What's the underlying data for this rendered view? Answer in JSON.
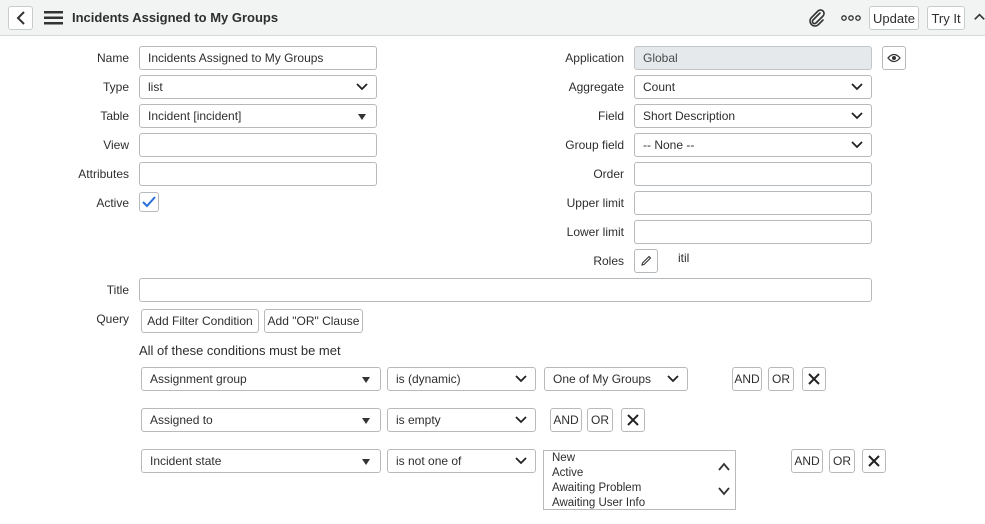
{
  "header": {
    "title": "Incidents Assigned to My Groups",
    "update_label": "Update",
    "try_it_label": "Try It"
  },
  "form": {
    "name": {
      "label": "Name",
      "value": "Incidents Assigned to My Groups"
    },
    "type": {
      "label": "Type",
      "value": "list"
    },
    "table": {
      "label": "Table",
      "value": "Incident [incident]"
    },
    "view": {
      "label": "View",
      "value": ""
    },
    "attributes": {
      "label": "Attributes",
      "value": ""
    },
    "active": {
      "label": "Active",
      "checked": true
    },
    "application": {
      "label": "Application",
      "value": "Global"
    },
    "aggregate": {
      "label": "Aggregate",
      "value": "Count"
    },
    "field": {
      "label": "Field",
      "value": "Short Description"
    },
    "group_field": {
      "label": "Group field",
      "value": "-- None --"
    },
    "order": {
      "label": "Order",
      "value": ""
    },
    "upper_limit": {
      "label": "Upper limit",
      "value": ""
    },
    "lower_limit": {
      "label": "Lower limit",
      "value": ""
    },
    "roles": {
      "label": "Roles",
      "value": "itil"
    },
    "title": {
      "label": "Title",
      "value": ""
    },
    "query": {
      "label": "Query",
      "add_filter_label": "Add Filter Condition",
      "add_or_label": "Add \"OR\" Clause",
      "conditions_heading": "All of these conditions must be met",
      "conditions": [
        {
          "field": "Assignment group",
          "operator": "is (dynamic)",
          "value": "One of My Groups",
          "and_label": "AND",
          "or_label": "OR"
        },
        {
          "field": "Assigned to",
          "operator": "is empty",
          "and_label": "AND",
          "or_label": "OR"
        },
        {
          "field": "Incident state",
          "operator": "is not one of",
          "values": [
            "New",
            "Active",
            "Awaiting Problem",
            "Awaiting User Info"
          ],
          "and_label": "AND",
          "or_label": "OR"
        }
      ]
    }
  },
  "icons": {
    "back": "chevron-left-icon",
    "menu": "hamburger-menu-icon",
    "attachment": "paperclip-icon",
    "more": "ellipsis-icon",
    "preview": "eye-icon",
    "edit": "pencil-icon",
    "remove": "close-icon"
  }
}
